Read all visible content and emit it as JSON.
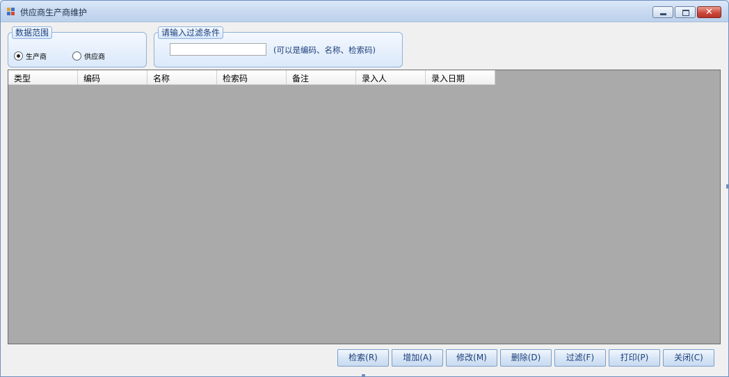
{
  "window": {
    "title": "供应商生产商维护"
  },
  "scope_group": {
    "legend": "数据范围",
    "options": [
      {
        "label": "生产商",
        "selected": true
      },
      {
        "label": "供应商",
        "selected": false
      }
    ]
  },
  "filter_group": {
    "legend": "请输入过滤条件",
    "input_value": "",
    "hint": "(可以是编码、名称、检索码)"
  },
  "grid": {
    "columns": [
      "类型",
      "编码",
      "名称",
      "检索码",
      "备注",
      "录入人",
      "录入日期"
    ]
  },
  "buttons": {
    "search": "检索(R)",
    "add": "增加(A)",
    "edit": "修改(M)",
    "delete": "删除(D)",
    "filter": "过滤(F)",
    "print": "打印(P)",
    "close": "关闭(C)"
  },
  "colors": {
    "grid_background": "#aaaaaa",
    "accent": "#1d3f7a",
    "close_button": "#c9463a"
  }
}
